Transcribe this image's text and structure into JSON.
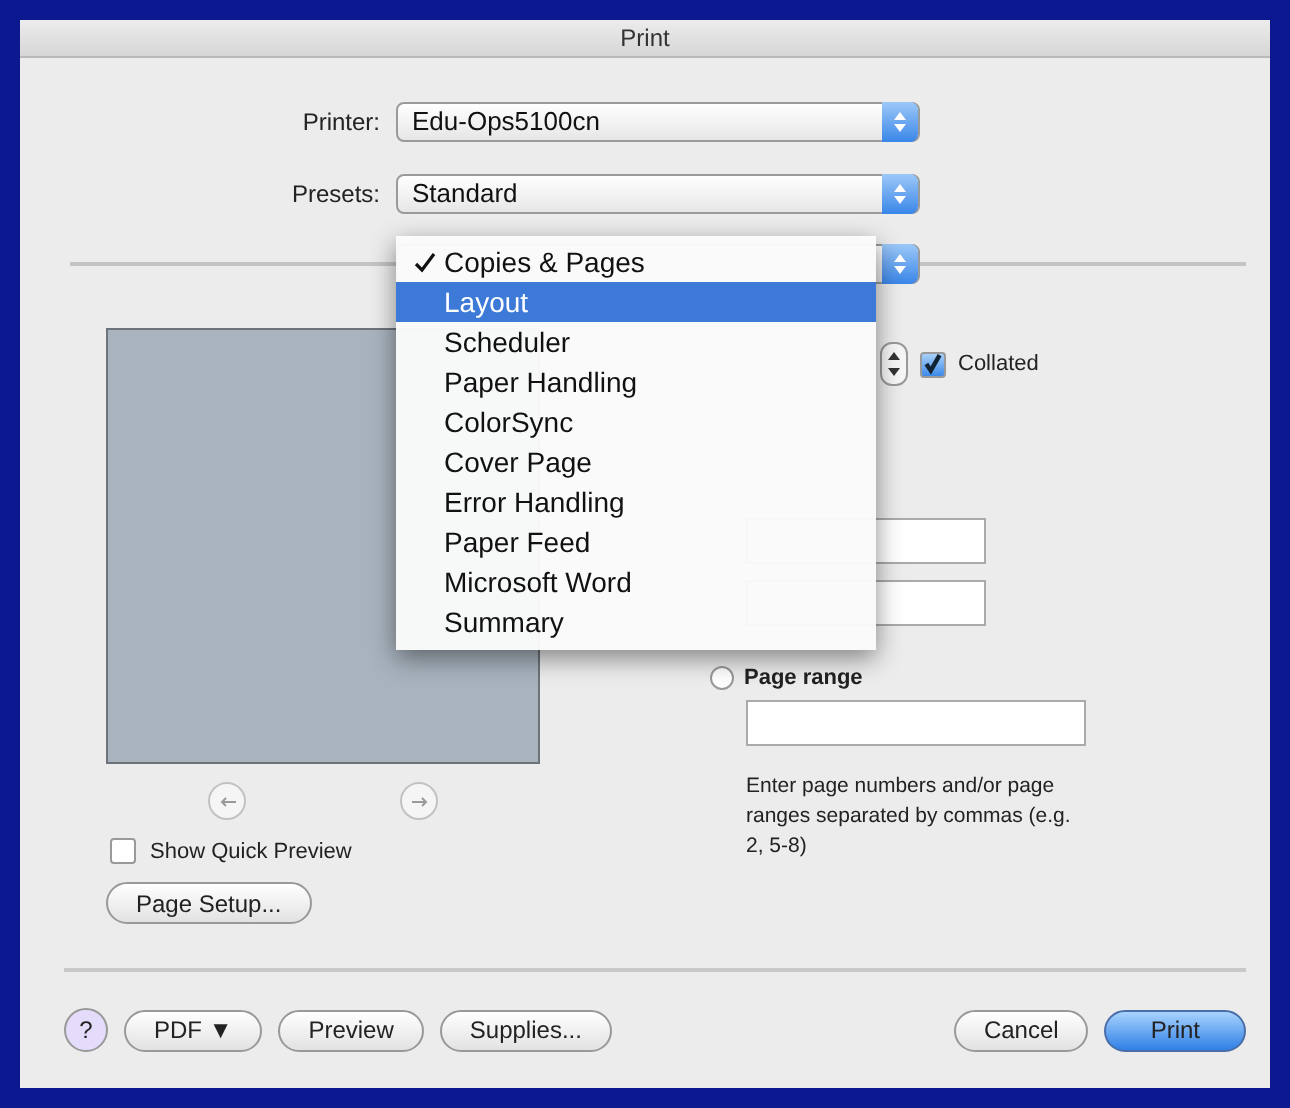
{
  "window": {
    "title": "Print"
  },
  "printer": {
    "label": "Printer:",
    "value": "Edu-Ops5100cn"
  },
  "presets": {
    "label": "Presets:",
    "value": "Standard"
  },
  "pane_menu": {
    "items": [
      {
        "label": "Copies & Pages",
        "checked": true,
        "selected": false
      },
      {
        "label": "Layout",
        "checked": false,
        "selected": true
      },
      {
        "label": "Scheduler",
        "checked": false,
        "selected": false
      },
      {
        "label": "Paper Handling",
        "checked": false,
        "selected": false
      },
      {
        "label": "ColorSync",
        "checked": false,
        "selected": false
      },
      {
        "label": "Cover Page",
        "checked": false,
        "selected": false
      },
      {
        "label": "Error Handling",
        "checked": false,
        "selected": false
      },
      {
        "label": "Paper Feed",
        "checked": false,
        "selected": false
      },
      {
        "label": "Microsoft Word",
        "checked": false,
        "selected": false
      },
      {
        "label": "Summary",
        "checked": false,
        "selected": false
      }
    ]
  },
  "copies": {
    "collated": {
      "label": "Collated",
      "checked": true
    }
  },
  "pages": {
    "page_range": {
      "label": "Page range",
      "selected": false
    },
    "hint": "Enter page numbers and/or page ranges separated by commas (e.g. 2, 5-8)"
  },
  "preview": {
    "show_quick_preview": {
      "label": "Show Quick Preview",
      "checked": false
    },
    "page_setup": "Page Setup..."
  },
  "buttons": [
    {
      "label": "?",
      "kind": "help"
    },
    {
      "label": "PDF ▼",
      "kind": "normal"
    },
    {
      "label": "Preview",
      "kind": "normal"
    },
    {
      "label": "Supplies...",
      "kind": "normal"
    },
    {
      "label": "Cancel",
      "kind": "normal"
    },
    {
      "label": "Print",
      "kind": "default"
    }
  ]
}
